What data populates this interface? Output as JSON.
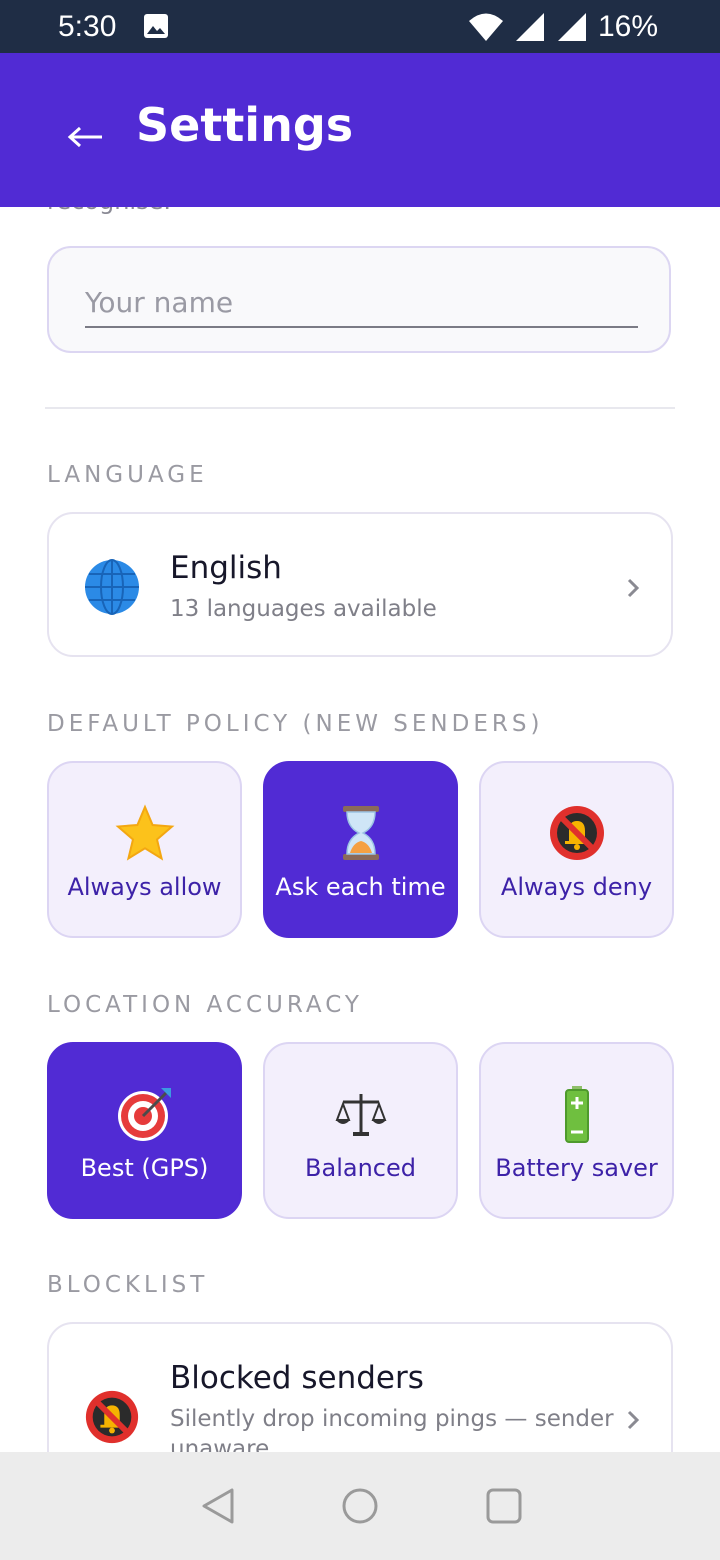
{
  "status_bar": {
    "time": "5:30",
    "battery": "16%"
  },
  "app_bar": {
    "title": "Settings"
  },
  "name_section": {
    "clipped_text": "recognise.",
    "placeholder": "Your name",
    "value": ""
  },
  "language": {
    "label": "LANGUAGE",
    "selected": "English",
    "subtitle": "13 languages available",
    "icon": "globe-icon"
  },
  "default_policy": {
    "label": "DEFAULT POLICY (NEW SENDERS)",
    "options": [
      {
        "label": "Always allow",
        "icon": "star-icon",
        "selected": false
      },
      {
        "label": "Ask each time",
        "icon": "hourglass-icon",
        "selected": true
      },
      {
        "label": "Always deny",
        "icon": "bell-off-icon",
        "selected": false
      }
    ]
  },
  "location_accuracy": {
    "label": "LOCATION ACCURACY",
    "options": [
      {
        "label": "Best (GPS)",
        "icon": "target-icon",
        "selected": true
      },
      {
        "label": "Balanced",
        "icon": "scales-icon",
        "selected": false
      },
      {
        "label": "Battery saver",
        "icon": "battery-icon",
        "selected": false
      }
    ]
  },
  "blocklist": {
    "label": "BLOCKLIST",
    "title": "Blocked senders",
    "subtitle": "Silently drop incoming pings — sender",
    "subtitle_overflow": "unaware.",
    "icon": "bell-off-icon"
  },
  "colors": {
    "primary": "#512bd4",
    "status_bar": "#1f2d45",
    "tile_bg": "#f3effc",
    "tile_text": "#3d22a8"
  }
}
